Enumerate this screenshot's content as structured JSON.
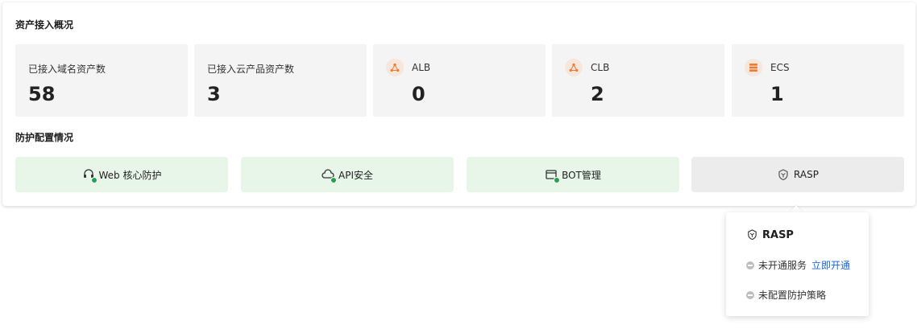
{
  "overview": {
    "title": "资产接入概况",
    "stats": [
      {
        "label": "已接入域名资产数",
        "value": "58"
      },
      {
        "label": "已接入云产品资产数",
        "value": "3"
      },
      {
        "label": "ALB",
        "value": "0",
        "icon": "share-nodes-icon"
      },
      {
        "label": "CLB",
        "value": "2",
        "icon": "share-nodes-icon"
      },
      {
        "label": "ECS",
        "value": "1",
        "icon": "server-stack-icon"
      }
    ]
  },
  "protection": {
    "title": "防护配置情况",
    "items": [
      {
        "label": "Web 核心防护",
        "icon": "headset-shield-icon",
        "enabled": true
      },
      {
        "label": "API安全",
        "icon": "cloud-api-icon",
        "enabled": true
      },
      {
        "label": "BOT管理",
        "icon": "bot-window-icon",
        "enabled": true
      },
      {
        "label": "RASP",
        "icon": "shield-icon",
        "enabled": false
      }
    ]
  },
  "popover": {
    "title": "RASP",
    "status_text": "未开通服务",
    "activate_link": "立即开通",
    "policy_text": "未配置防护策略"
  },
  "colors": {
    "accent_link": "#1a66d9",
    "enabled_bg": "#e8f6ea",
    "disabled_bg": "#ececec",
    "icon_orange": "#f07a2f",
    "check_green": "#1ea54c"
  }
}
